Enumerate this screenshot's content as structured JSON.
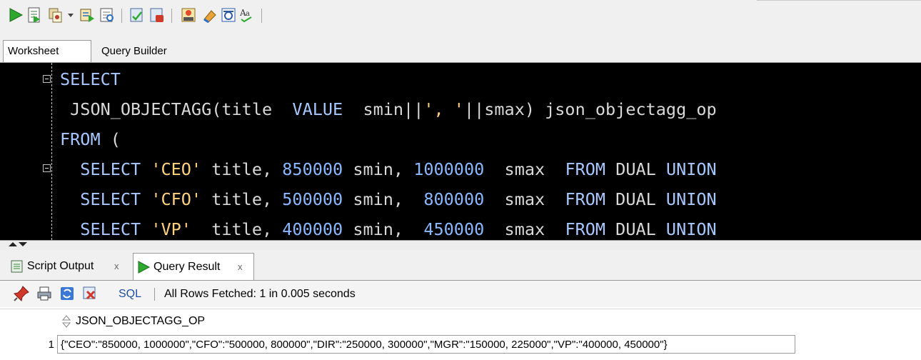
{
  "toolbar": {
    "icons": [
      "run-statement-icon",
      "run-script-icon",
      "commit-icon",
      "dropdown-arrow-icon",
      "autotrace-icon",
      "explain-plan-icon",
      "sql-tuning-icon",
      "rollback-icon",
      "sql-history-icon",
      "clear-icon",
      "format-icon",
      "spell-check-icon"
    ]
  },
  "worksheet_tabs": [
    {
      "label": "Worksheet",
      "active": true
    },
    {
      "label": "Query Builder",
      "active": false
    }
  ],
  "editor": {
    "lines": [
      [
        {
          "t": "kw",
          "v": "SELECT"
        }
      ],
      [
        {
          "t": "tx",
          "v": " JSON_OBJECTAGG(title  "
        },
        {
          "t": "kw",
          "v": "VALUE"
        },
        {
          "t": "tx",
          "v": "  smin||"
        },
        {
          "t": "str",
          "v": "', '"
        },
        {
          "t": "tx",
          "v": "||smax) json_objectagg_op"
        }
      ],
      [
        {
          "t": "kw",
          "v": "FROM"
        },
        {
          "t": "tx",
          "v": " ("
        }
      ],
      [
        {
          "t": "tx",
          "v": "  "
        },
        {
          "t": "kw",
          "v": "SELECT"
        },
        {
          "t": "tx",
          "v": " "
        },
        {
          "t": "str",
          "v": "'CEO'"
        },
        {
          "t": "tx",
          "v": " title, "
        },
        {
          "t": "num",
          "v": "850000"
        },
        {
          "t": "tx",
          "v": " smin, "
        },
        {
          "t": "num",
          "v": "1000000"
        },
        {
          "t": "tx",
          "v": "  smax  "
        },
        {
          "t": "kw",
          "v": "FROM"
        },
        {
          "t": "tx",
          "v": " DUAL "
        },
        {
          "t": "kw",
          "v": "UNION"
        }
      ],
      [
        {
          "t": "tx",
          "v": "  "
        },
        {
          "t": "kw",
          "v": "SELECT"
        },
        {
          "t": "tx",
          "v": " "
        },
        {
          "t": "str",
          "v": "'CFO'"
        },
        {
          "t": "tx",
          "v": " title, "
        },
        {
          "t": "num",
          "v": "500000"
        },
        {
          "t": "tx",
          "v": " smin,  "
        },
        {
          "t": "num",
          "v": "800000"
        },
        {
          "t": "tx",
          "v": "  smax  "
        },
        {
          "t": "kw",
          "v": "FROM"
        },
        {
          "t": "tx",
          "v": " DUAL "
        },
        {
          "t": "kw",
          "v": "UNION"
        }
      ],
      [
        {
          "t": "tx",
          "v": "  "
        },
        {
          "t": "kw",
          "v": "SELECT"
        },
        {
          "t": "tx",
          "v": " "
        },
        {
          "t": "str",
          "v": "'VP'"
        },
        {
          "t": "tx",
          "v": "  title, "
        },
        {
          "t": "num",
          "v": "400000"
        },
        {
          "t": "tx",
          "v": " smin,  "
        },
        {
          "t": "num",
          "v": "450000"
        },
        {
          "t": "tx",
          "v": "  smax  "
        },
        {
          "t": "kw",
          "v": "FROM"
        },
        {
          "t": "tx",
          "v": " DUAL "
        },
        {
          "t": "kw",
          "v": "UNION"
        }
      ]
    ]
  },
  "output_tabs": [
    {
      "label": "Script Output",
      "close": "x",
      "active": false
    },
    {
      "label": "Query Result",
      "close": "x",
      "active": true
    }
  ],
  "result_toolbar": {
    "sql_link": "SQL",
    "status": "All Rows Fetched: 1 in 0.005 seconds"
  },
  "grid": {
    "column": "JSON_OBJECTAGG_OP",
    "rows": [
      {
        "num": "1",
        "value": "{\"CEO\":\"850000, 1000000\",\"CFO\":\"500000, 800000\",\"DIR\":\"250000, 300000\",\"MGR\":\"150000, 225000\",\"VP\":\"400000, 450000\"}"
      }
    ]
  }
}
